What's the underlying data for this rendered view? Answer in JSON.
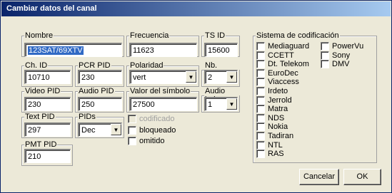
{
  "window": {
    "title": "Cambiar datos del canal"
  },
  "fields": {
    "nombre": {
      "label": "Nombre",
      "value": "123SAT/69XTV"
    },
    "frecuencia": {
      "label": "Frecuencia",
      "value": "11623"
    },
    "ts_id": {
      "label": "TS ID",
      "value": "15600"
    },
    "ch_id": {
      "label": "Ch. ID",
      "value": "10710"
    },
    "pcr_pid": {
      "label": "PCR PID",
      "value": "230"
    },
    "polaridad": {
      "label": "Polaridad",
      "value": "vert"
    },
    "nb_audio": {
      "label": "Nb. audio",
      "value": "2"
    },
    "video_pid": {
      "label": "Video PID",
      "value": "230"
    },
    "audio_pid": {
      "label": "Audio PID",
      "value": "250"
    },
    "symbol_rate": {
      "label": "Valor del símbolo",
      "value": "27500"
    },
    "audio_index": {
      "label": "Audio index",
      "value": "1"
    },
    "text_pid": {
      "label": "Text PID",
      "value": "297"
    },
    "pids": {
      "label": "PIDs",
      "value": "Dec"
    },
    "pmt_pid": {
      "label": "PMT PID",
      "value": "210"
    }
  },
  "flags": [
    {
      "label": "codificado",
      "checked": false,
      "disabled": true
    },
    {
      "label": "bloqueado",
      "checked": false,
      "disabled": false
    },
    {
      "label": "omitido",
      "checked": false,
      "disabled": false
    }
  ],
  "encoding": {
    "label": "Sistema de codificación",
    "col1": [
      "Mediaguard",
      "CCETT",
      "Dt. Telekom",
      "EuroDec",
      "Viaccess",
      "Irdeto",
      "Jerrold",
      "Matra",
      "NDS",
      "Nokia",
      "Tadiran",
      "NTL",
      "RAS"
    ],
    "col2": [
      "PowerVu",
      "Sony",
      "DMV"
    ]
  },
  "buttons": {
    "cancel": "Cancelar",
    "ok": "OK"
  }
}
